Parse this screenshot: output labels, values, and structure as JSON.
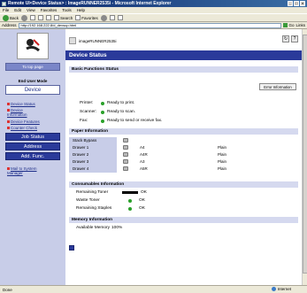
{
  "browser": {
    "title": "Remote UI<Device Status> : ImageRUNNER2535i - Microsoft Internet Explorer",
    "menu": [
      "File",
      "Edit",
      "View",
      "Favorites",
      "Tools",
      "Help"
    ],
    "toolbar": {
      "back": "Back",
      "search": "Search",
      "favorites": "Favorites"
    },
    "address_label": "Address",
    "address": "http://192.168.222.8/d_devsup.html",
    "go": "Go",
    "links": "Links",
    "status_text": "Done",
    "zone": "Internet"
  },
  "sidebar": {
    "to_top": "To top page",
    "mode_label": "End User Mode",
    "mode_button": "Device",
    "links": [
      "Device Status",
      "Device Information",
      "Device Features",
      "Counter Check"
    ],
    "buttons": [
      "Job Status",
      "Address",
      "Add. Func."
    ],
    "mail_link": "Mail to System Manager"
  },
  "main": {
    "device_name": "imageRUNNER2535i",
    "title": "Device Status",
    "basic_section": "Basic Functions Status",
    "error_button": "Error Information",
    "status": [
      {
        "label": "Printer:",
        "value": "Ready to print."
      },
      {
        "label": "Scanner:",
        "value": "Ready to scan."
      },
      {
        "label": "Fax:",
        "value": "Ready to send or receive fax."
      }
    ],
    "paper_section": "Paper Information",
    "paper": [
      {
        "name": "Stack Bypass",
        "size": "",
        "type": ""
      },
      {
        "name": "Drawer 1",
        "size": "A4",
        "type": "Plain"
      },
      {
        "name": "Drawer 2",
        "size": "A4R",
        "type": "Plain"
      },
      {
        "name": "Drawer 3",
        "size": "A3",
        "type": "Plain"
      },
      {
        "name": "Drawer 4",
        "size": "A5R",
        "type": "Plain"
      }
    ],
    "consumables_section": "Consumables Information",
    "consumables": [
      {
        "label": "Remaining Toner",
        "value": "OK"
      },
      {
        "label": "Waste Toner",
        "value": "OK"
      },
      {
        "label": "Remaining Staples",
        "value": "OK"
      }
    ],
    "memory_section": "Memory Information",
    "memory_label": "Available Memory",
    "memory_value": "100%"
  }
}
